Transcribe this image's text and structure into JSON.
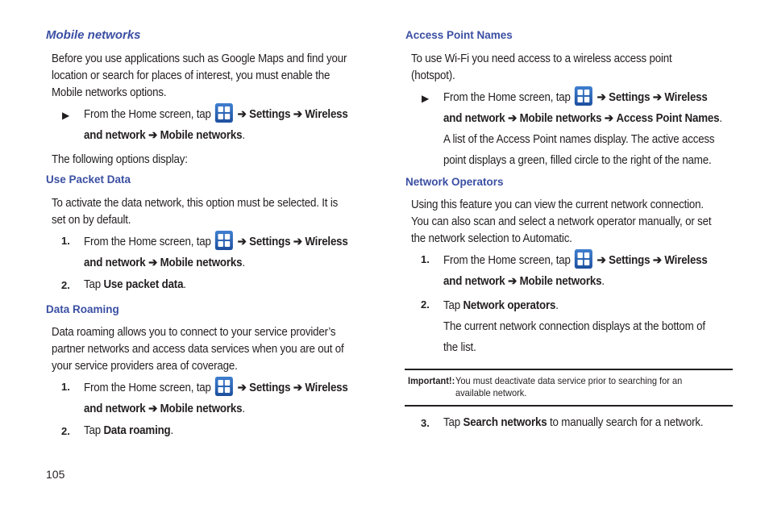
{
  "page_number": "105",
  "arrow": "➔",
  "left": {
    "mobile_networks": {
      "heading": "Mobile networks",
      "intro": [
        "Before you use applications such as Google Maps and find your",
        "location or search for places of interest, you must enable the",
        "Mobile networks options."
      ],
      "step": {
        "marker": "▶",
        "prefix": "From the Home screen, tap",
        "settings": "Settings",
        "wireless": "Wireless",
        "and_network": "and network",
        "mobile_networks": "Mobile networks",
        "end": "."
      },
      "following": "The following options display:"
    },
    "use_packet_data": {
      "heading": "Use Packet Data",
      "intro": [
        "To activate the data network, this option must be selected. It is",
        "set on by default."
      ],
      "step1": {
        "marker": "1.",
        "prefix": "From the Home screen, tap",
        "settings": "Settings",
        "wireless": "Wireless",
        "and_network": "and network",
        "mobile_networks": "Mobile networks",
        "end": "."
      },
      "step2": {
        "marker": "2.",
        "prefix": "Tap ",
        "bold": "Use packet data",
        "end": "."
      }
    },
    "data_roaming": {
      "heading": "Data Roaming",
      "intro": [
        "Data roaming allows you to connect to your service provider’s",
        "partner networks and access data services when you are out of",
        "your service providers area of coverage."
      ],
      "step1": {
        "marker": "1.",
        "prefix": "From the Home screen, tap",
        "settings": "Settings",
        "wireless": "Wireless",
        "and_network": "and network",
        "mobile_networks": "Mobile networks",
        "end": "."
      },
      "step2": {
        "marker": "2.",
        "prefix": "Tap ",
        "bold": "Data roaming",
        "end": "."
      }
    }
  },
  "right": {
    "access_point_names": {
      "heading": "Access Point Names",
      "intro": [
        "To use Wi-Fi you need access to a wireless access point",
        "(hotspot)."
      ],
      "step": {
        "marker": "▶",
        "prefix": "From the Home screen, tap",
        "settings": "Settings",
        "wireless": "Wireless",
        "and_network": "and network",
        "mobile_networks": "Mobile networks",
        "apn": "Access Point Names",
        "end": "."
      },
      "result": [
        "A list of the Access Point names display. The active access",
        "point displays a green, filled circle to the right of the name."
      ]
    },
    "network_operators": {
      "heading": "Network Operators",
      "intro": [
        "Using this feature you can view the current network connection.",
        "You can also scan and select a network operator manually, or set",
        "the network selection to Automatic."
      ],
      "step1": {
        "marker": "1.",
        "prefix": "From the Home screen, tap",
        "settings": "Settings",
        "wireless": "Wireless",
        "and_network": "and network",
        "mobile_networks": "Mobile networks",
        "end": "."
      },
      "step2": {
        "marker": "2.",
        "prefix": "Tap ",
        "bold": "Network operators",
        "end": "."
      },
      "step2_result": [
        "The current network connection displays at the bottom of",
        "the list."
      ],
      "important": {
        "label": "Important!:",
        "lines": [
          "You must deactivate data service prior to searching for an",
          "available network."
        ]
      },
      "step3": {
        "marker": "3.",
        "prefix": "Tap ",
        "bold": "Search networks",
        "suffix": " to manually search for a network."
      }
    }
  }
}
